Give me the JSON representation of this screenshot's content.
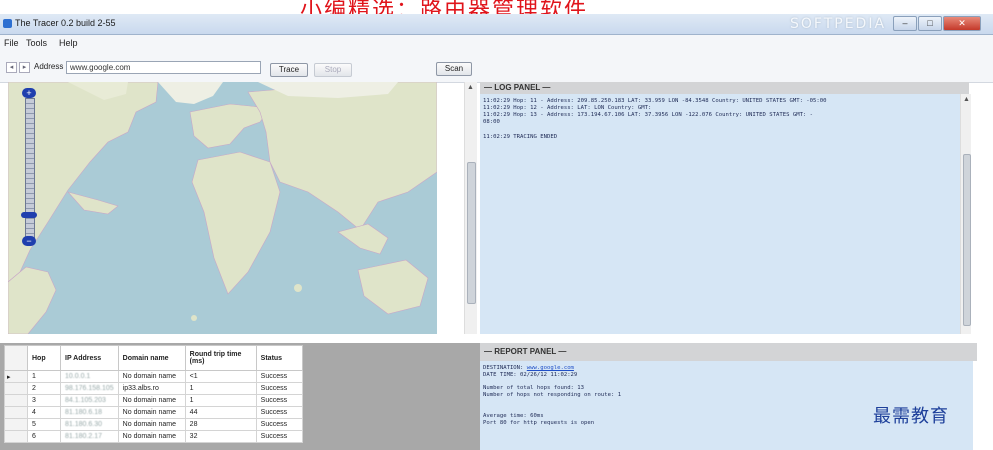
{
  "banner": {
    "text": "小编精选：路由器管理软件"
  },
  "window": {
    "title": "The Tracer 0.2 build 2-55",
    "watermark": "SOFTPEDIA"
  },
  "menu": [
    "File",
    "Tools",
    "Help"
  ],
  "toolbar": {
    "back_glyph": "◂",
    "forward_glyph": "▸",
    "address_label": "Address",
    "address_value": "www.google.com",
    "trace_button": "Trace",
    "stop_button": "Stop",
    "scan_button": "Scan"
  },
  "map": {
    "zoom_in": "+",
    "zoom_out": "−"
  },
  "log": {
    "header": "— LOG PANEL —",
    "lines": [
      "11:02:29 Hop: 11 - Address: 209.85.250.183 LAT: 33.959 LON -84.3548 Country: UNITED STATES GMT: -05:00",
      "11:02:29 Hop: 12 - Address:  LAT:  LON  Country:  GMT:",
      "11:02:29 Hop: 13 - Address: 173.194.67.106 LAT: 37.3956 LON -122.076 Country: UNITED STATES GMT: -",
      "08:00",
      "",
      "11:02:29 TRACING ENDED"
    ]
  },
  "hops_table": {
    "columns": [
      "Hop",
      "IP Address",
      "Domain name",
      "Round trip time (ms)",
      "Status"
    ],
    "rows": [
      {
        "hop": "1",
        "ip": "10.0.0.1",
        "domain": "No domain name",
        "rtt": "<1",
        "status": "Success"
      },
      {
        "hop": "2",
        "ip": "98.176.158.105",
        "domain": "ip33.albs.ro",
        "rtt": "1",
        "status": "Success"
      },
      {
        "hop": "3",
        "ip": "84.1.105.203",
        "domain": "No domain name",
        "rtt": "1",
        "status": "Success"
      },
      {
        "hop": "4",
        "ip": "81.180.6.18",
        "domain": "No domain name",
        "rtt": "44",
        "status": "Success"
      },
      {
        "hop": "5",
        "ip": "81.180.6.30",
        "domain": "No domain name",
        "rtt": "28",
        "status": "Success"
      },
      {
        "hop": "6",
        "ip": "81.180.2.17",
        "domain": "No domain name",
        "rtt": "32",
        "status": "Success"
      }
    ]
  },
  "report": {
    "header": "— REPORT PANEL —",
    "destination_prefix": "DESTINATION: ",
    "destination": "www.google.com",
    "date_time": "DATE TIME: 02/26/12 11:02:29",
    "total_hops": "Number of total hops found: 13",
    "no_response": "Number of hops not responding on route: 1",
    "avg_time": "Average time: 60ms",
    "http_note": "Port 80 for http requests is open"
  },
  "edu_watermark": "最需教育",
  "colors": {
    "banner_red": "#e0141b",
    "log_bg": "#d6e6f5",
    "zoom_blue": "#1f3fae",
    "edu_blue": "#1d3f9a"
  }
}
